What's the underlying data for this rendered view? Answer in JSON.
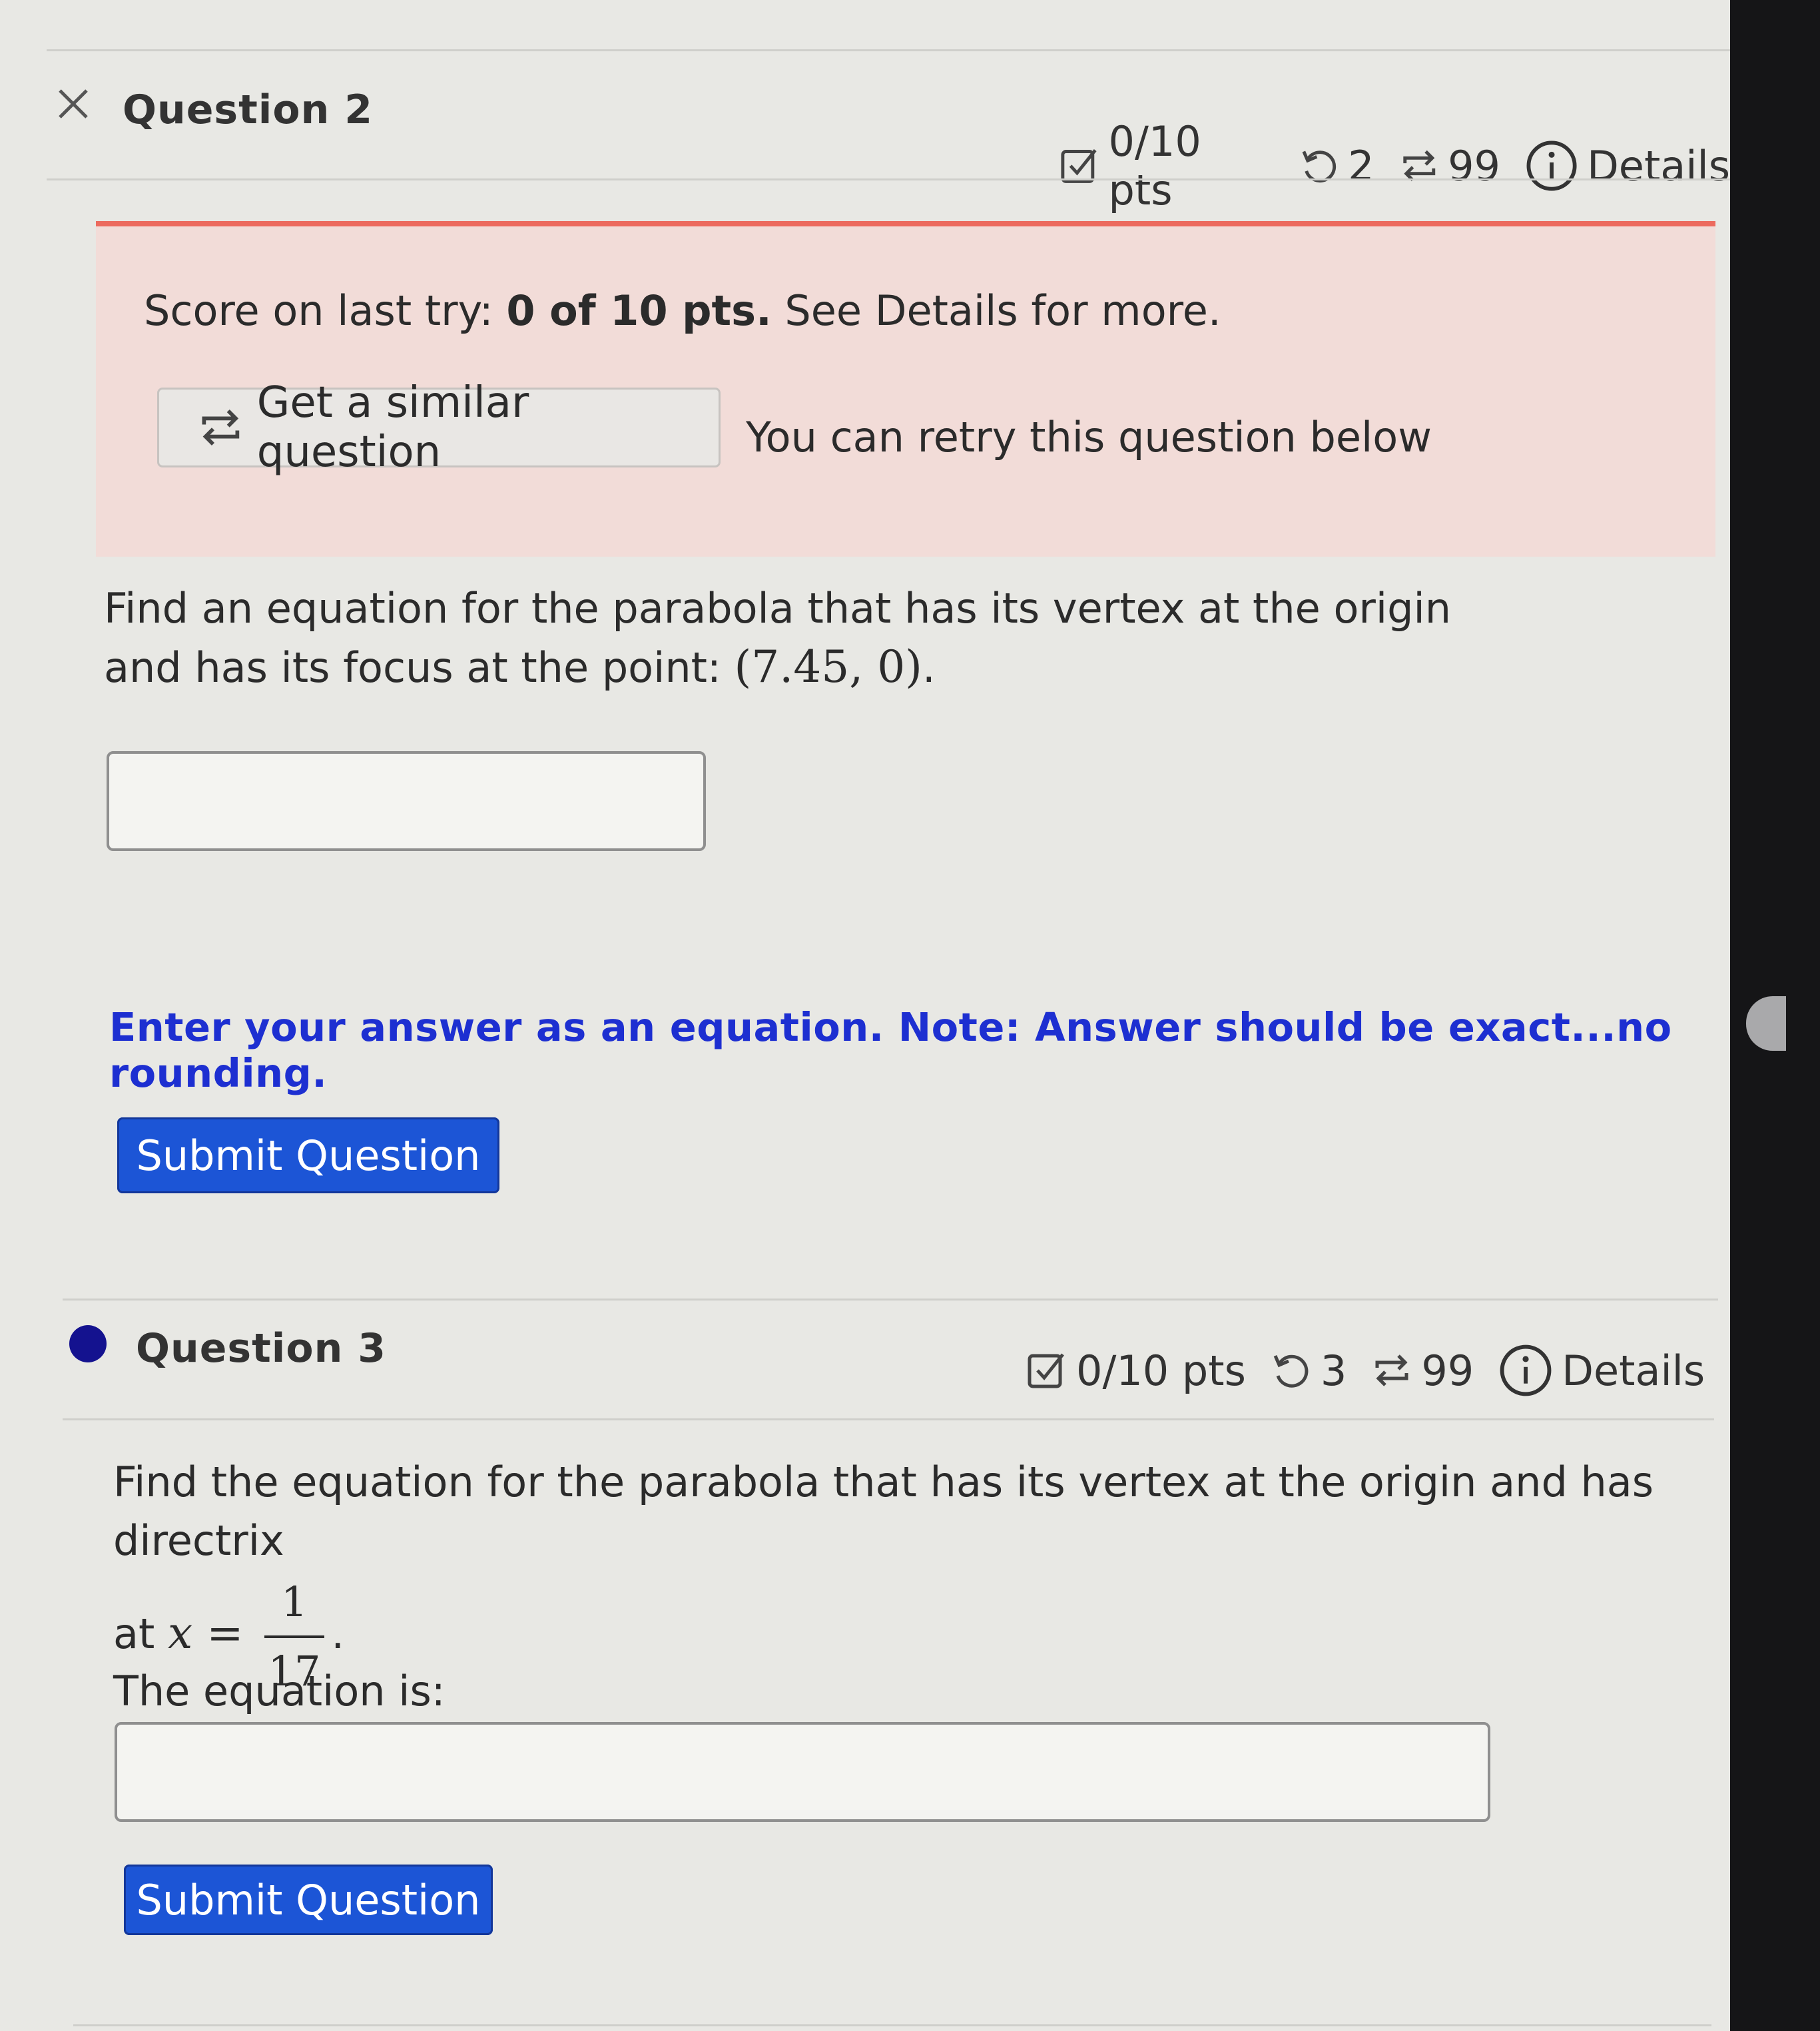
{
  "question2": {
    "title": "Question 2",
    "points": "0/10 pts",
    "attempts": "2",
    "retries": "99",
    "details_label": "Details",
    "banner": {
      "score_prefix": "Score on last try: ",
      "score_value": "0 of 10 pts.",
      "score_suffix": " See Details for more.",
      "similar_button": "Get a similar question",
      "retry_note": "You can retry this question below"
    },
    "prompt_line1": "Find an equation for the parabola that has its vertex at the origin",
    "prompt_line2": "and has its focus at the point: ",
    "prompt_point": "(7.45, 0)",
    "prompt_end": ".",
    "answer_value": "",
    "hint": "Enter your answer as an equation. Note: Answer should be exact...no rounding.",
    "submit_label": "Submit Question"
  },
  "question3": {
    "title": "Question 3",
    "points": "0/10 pts",
    "attempts": "3",
    "retries": "99",
    "details_label": "Details",
    "prompt_line1": "Find the equation for the parabola that has its vertex at the origin and has directrix",
    "prompt_at": "at ",
    "prompt_var": "x",
    "prompt_eq": " = ",
    "frac_num": "1",
    "frac_den": "17",
    "prompt_end": ".",
    "equation_label": "The equation is:",
    "answer_value": "",
    "submit_label": "Submit Question"
  },
  "colors": {
    "banner_bg": "#f2dcd8",
    "banner_accent": "#ec6a5e",
    "hint_text": "#1d2fd1",
    "submit_bg": "#1c55d6",
    "status_dot": "#14128f"
  },
  "icons": [
    "close-icon",
    "checkbox-icon",
    "retry-icon",
    "swap-icon",
    "info-icon",
    "status-dot-icon"
  ]
}
